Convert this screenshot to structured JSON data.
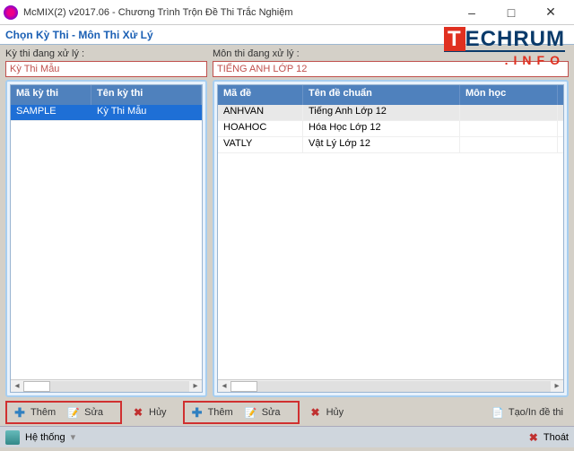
{
  "window": {
    "title": "McMIX(2) v2017.06 - Chương Trình Trộn Đề Thi Trắc Nghiệm",
    "minimize": "–",
    "maximize": "□",
    "close": "✕"
  },
  "header": {
    "title": "Chọn Kỳ Thi - Môn Thi Xử Lý"
  },
  "left": {
    "label": "Kỳ thi đang xử lý :",
    "input": "Kỳ Thi Mẫu",
    "columns": {
      "code": "Mã kỳ thi",
      "name": "Tên kỳ thi"
    },
    "rows": [
      {
        "code": "SAMPLE",
        "name": "Kỳ Thi Mẫu",
        "selected": true
      }
    ]
  },
  "right": {
    "label": "Môn thi đang xử lý :",
    "input": "TIẾNG ANH LỚP 12",
    "columns": {
      "code": "Mã đề",
      "name": "Tên đề chuẩn",
      "subject": "Môn học"
    },
    "rows": [
      {
        "code": "ANHVAN",
        "name": "Tiếng Anh Lớp 12",
        "subject": "",
        "gray": true
      },
      {
        "code": "HOAHOC",
        "name": "Hóa Học Lớp 12",
        "subject": ""
      },
      {
        "code": "VATLY",
        "name": "Vật Lý Lớp 12",
        "subject": ""
      }
    ]
  },
  "toolbar": {
    "add": "Thêm",
    "edit": "Sửa",
    "cancel": "Hủy",
    "create": "Tạo/In đề thi"
  },
  "status": {
    "system": "Hệ thống",
    "exit": "Thoát"
  },
  "watermark": {
    "brand_a": "T",
    "brand_b": "ECHRUM",
    "sub": ".INFO"
  }
}
